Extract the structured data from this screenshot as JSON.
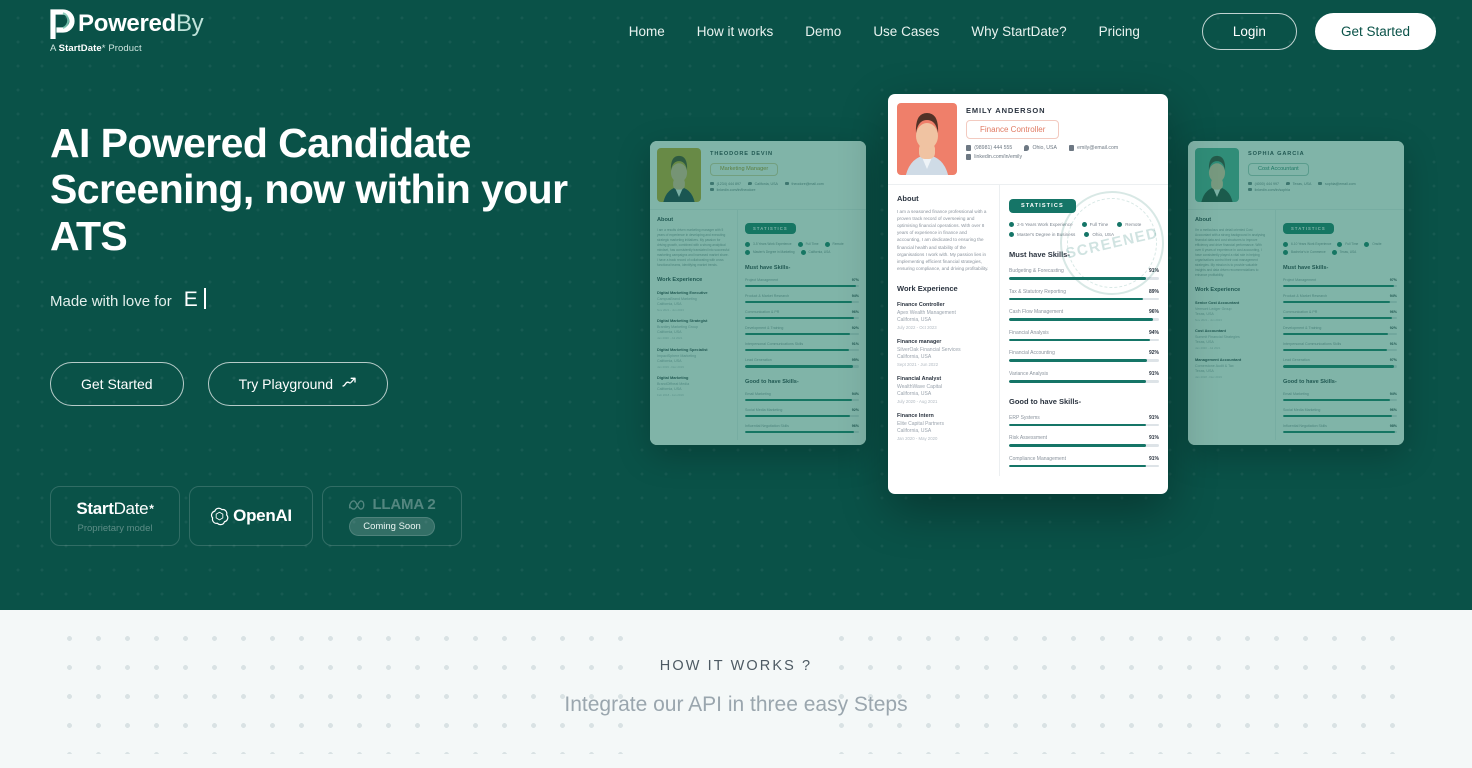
{
  "theme": {
    "hero_bg": "#0a5248",
    "accent": "#157567",
    "bottom_bg": "#f4f8f8"
  },
  "nav": {
    "brand": {
      "powered": "Powered",
      "by": "By",
      "sub_prefix": "A ",
      "sub_brand": "StartDate",
      "sub_suffix": "* Product"
    },
    "links": [
      {
        "label": "Home"
      },
      {
        "label": "How it works"
      },
      {
        "label": "Demo"
      },
      {
        "label": "Use Cases"
      },
      {
        "label": "Why StartDate?"
      },
      {
        "label": "Pricing"
      }
    ],
    "login_label": "Login",
    "get_started_label": "Get Started"
  },
  "hero": {
    "headline_line1": "AI Powered Candidate",
    "headline_line2": "Screening, now within your ATS",
    "tagline_prefix": "Made with love for",
    "tagline_typed": "E",
    "cta_primary": "Get Started",
    "cta_secondary": "Try Playground",
    "cta_secondary_icon": "trending-up-arrow-icon"
  },
  "models": [
    {
      "name_bold": "Start",
      "name_thin": "Date",
      "mark": "*",
      "sub": "Proprietary model"
    },
    {
      "icon": "openai-logo-icon",
      "name": "OpenAI"
    },
    {
      "icon": "meta-infinity-icon",
      "name": "LLAMA 2",
      "badge": "Coming Soon"
    }
  ],
  "resumes": [
    {
      "id": "theodore",
      "name": "THEODORE DEVIN",
      "role": "Marketing Manager",
      "phone": "(1234) 444 897",
      "location": "Califonia, USA",
      "email": "theodore@mail.com",
      "linkedin": "linkedin.com/in/theodore",
      "about_heading": "About",
      "about": "I am a results driven marketing manager with 5 years of experience in developing and executing strategic marketing initiatives. My passion for driving growth, combined with a strong analytical mindset, has consistently translated into successful marketing campaigns and increased market share. I have a track record of collaborating with cross functional teams, identifying market trends.",
      "statistics_label": "STATISTICS",
      "chips": [
        "3-5 Years Work Experience",
        "Full Time",
        "Remote",
        "Master's Degree in Marketing",
        "California, USA"
      ],
      "must_heading": "Must have Skills-",
      "must_skills": [
        {
          "name": "Project Management",
          "pct": "97%",
          "value": 97
        },
        {
          "name": "Product & Market Research",
          "pct": "94%",
          "value": 94
        },
        {
          "name": "Communication & PR",
          "pct": "96%",
          "value": 96
        },
        {
          "name": "Development & Training",
          "pct": "92%",
          "value": 92
        },
        {
          "name": "Interpersonal Communications Skills",
          "pct": "91%",
          "value": 91
        },
        {
          "name": "Lead Generation",
          "pct": "95%",
          "value": 95
        }
      ],
      "good_heading": "Good to have Skills-",
      "good_skills": [
        {
          "name": "Email Marketing",
          "pct": "94%",
          "value": 94
        },
        {
          "name": "Social Media Marketing",
          "pct": "92%",
          "value": 92
        },
        {
          "name": "Influential Negotiation Skills",
          "pct": "96%",
          "value": 96
        }
      ],
      "work_heading": "Work Experience",
      "jobs": [
        {
          "title": "Digital Marketing Executive",
          "company": "CampusBrand Marketing",
          "location": "California, USA",
          "dates": "Nov 2021 - Jun 2023"
        },
        {
          "title": "Digital Marketing Strategist",
          "company": "Brantley Marketing Group",
          "location": "California, USA",
          "dates": "Jan 2020 - Jul 2021"
        },
        {
          "title": "Digital Marketing Specialist",
          "company": "ImpactSphere Marketing",
          "location": "California, USA",
          "dates": "Jan 2019 - Dec 2019"
        },
        {
          "title": "Digital Marketing",
          "company": "BrandOffbeat Media",
          "location": "California, USA",
          "dates": "Feb 2018 - Jan 2019"
        }
      ]
    },
    {
      "id": "emily",
      "name": "EMILY ANDERSON",
      "role": "Finance Controller",
      "phone": "(98981) 444 555",
      "location": "Ohio, USA",
      "email": "emily@email.com",
      "linkedin": "linkedin.com/in/emily",
      "about_heading": "About",
      "about": "I am a seasoned finance professional with a proven track record of overseeing and optimising financial operations. With over 8 years of experience in finance and accounting, I am dedicated to ensuring the financial health and stability of the organisations I work with. My passion lies in implementing efficient financial strategies, ensuring compliance, and driving profitability.",
      "statistics_label": "STATISTICS",
      "chips": [
        "2-5 Years Work Experience",
        "Full Time",
        "Remote",
        "Master's Degree in Business",
        "Ohio, USA"
      ],
      "must_heading": "Must have Skills-",
      "must_skills": [
        {
          "name": "Budgeting & Forecasting",
          "pct": "91%",
          "value": 91
        },
        {
          "name": "Tax & Statutory Reporting",
          "pct": "89%",
          "value": 89
        },
        {
          "name": "Cash Flow Management",
          "pct": "96%",
          "value": 96
        },
        {
          "name": "Financial Analysis",
          "pct": "94%",
          "value": 94
        },
        {
          "name": "Financial Accounting",
          "pct": "92%",
          "value": 92
        },
        {
          "name": "Variance Analysis",
          "pct": "91%",
          "value": 91
        }
      ],
      "good_heading": "Good to have Skills-",
      "good_skills": [
        {
          "name": "ERP Systems",
          "pct": "91%",
          "value": 91
        },
        {
          "name": "Risk Assessment",
          "pct": "91%",
          "value": 91
        },
        {
          "name": "Compliance Management",
          "pct": "91%",
          "value": 91
        }
      ],
      "work_heading": "Work Experience",
      "jobs": [
        {
          "title": "Finance Controller",
          "company": "Apex Wealth Management",
          "location": "California, USA",
          "dates": "July 2022 - Oct 2023"
        },
        {
          "title": "Finance manager",
          "company": "SilverOak Financial Services",
          "location": "California, USA",
          "dates": "Sept 2021 - Jun 2022"
        },
        {
          "title": "Financial Analyst",
          "company": "WealthWave Capital",
          "location": "California, USA",
          "dates": "July 2020 - Aug 2021"
        },
        {
          "title": "Finance Intern",
          "company": "Elite Capital Partners",
          "location": "California, USA",
          "dates": "Jan 2020 - May 2020"
        }
      ],
      "stamp_text": "SCREENED"
    },
    {
      "id": "sophia",
      "name": "SOPHIA GARCIA",
      "role": "Cost Accountant",
      "phone": "(4000) 444 997",
      "location": "Texas, USA",
      "email": "sophia@email.com",
      "linkedin": "linkedin.com/in/sophia",
      "about_heading": "About",
      "about": "I'm a meticulous and detail oriented Cost Accountant with a strong background in analysing financial data and cost structures to improve efficiency and drive financial performance. With over 6 years of experience in cost accounting, I have consistently played a vital role in helping organisations control their cost management strategies. My mission is to provide valuable insights and data driven recommendations to enhance profitability.",
      "statistics_label": "STATISTICS",
      "chips": [
        "6-10 Years Work Experience",
        "Full Time",
        "Onsite",
        "Bachelor's in Commerce",
        "Texas, USA"
      ],
      "must_heading": "Must have Skills-",
      "must_skills": [
        {
          "name": "Project Management",
          "pct": "97%",
          "value": 97
        },
        {
          "name": "Product & Market Research",
          "pct": "94%",
          "value": 94
        },
        {
          "name": "Communication & PR",
          "pct": "96%",
          "value": 96
        },
        {
          "name": "Development & Training",
          "pct": "92%",
          "value": 92
        },
        {
          "name": "Interpersonal Communications Skills",
          "pct": "91%",
          "value": 91
        },
        {
          "name": "Lead Generation",
          "pct": "97%",
          "value": 97
        }
      ],
      "good_heading": "Good to have Skills-",
      "good_skills": [
        {
          "name": "Email Marketing",
          "pct": "94%",
          "value": 94
        },
        {
          "name": "Social Media Marketing",
          "pct": "96%",
          "value": 96
        },
        {
          "name": "Influential Negotiation Skills",
          "pct": "98%",
          "value": 98
        }
      ],
      "work_heading": "Work Experience",
      "jobs": [
        {
          "title": "Senior Cost Accountant",
          "company": "Vermont Ledger Group",
          "location": "Texas, USA",
          "dates": "Nov 2021 - Jun 2023"
        },
        {
          "title": "Cost Accountant",
          "company": "Summit Financial Strategies",
          "location": "Texas, USA",
          "dates": "Jan 2020 - Jul 2021"
        },
        {
          "title": "Management Accountant",
          "company": "Cornerstone Audit & Tax",
          "location": "Texas, USA",
          "dates": "Jan 2018 - Dec 2019"
        }
      ]
    }
  ],
  "bottom": {
    "kicker": "HOW IT WORKS ?",
    "title": "Integrate our API in three easy Steps"
  }
}
